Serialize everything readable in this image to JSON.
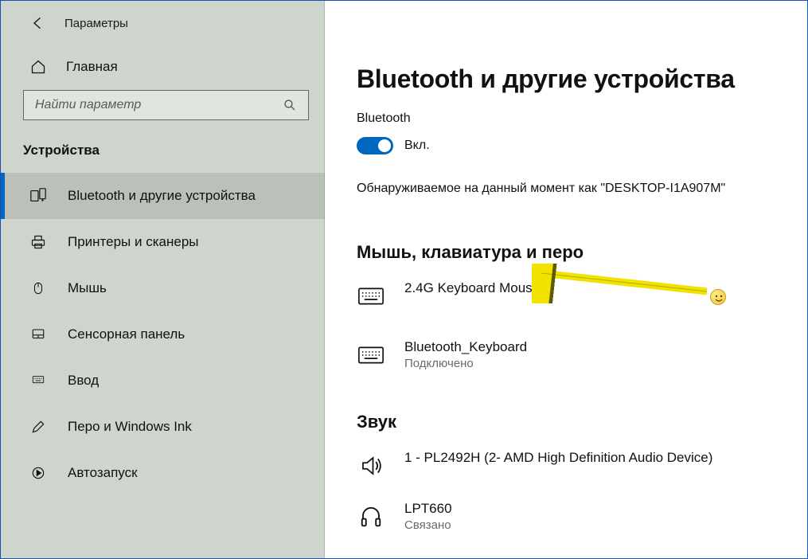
{
  "header": {
    "app_title": "Параметры"
  },
  "sidebar": {
    "home_label": "Главная",
    "search_placeholder": "Найти параметр",
    "category_label": "Устройства",
    "items": [
      {
        "label": "Bluetooth и другие устройства"
      },
      {
        "label": "Принтеры и сканеры"
      },
      {
        "label": "Мышь"
      },
      {
        "label": "Сенсорная панель"
      },
      {
        "label": "Ввод"
      },
      {
        "label": "Перо и Windows Ink"
      },
      {
        "label": "Автозапуск"
      }
    ]
  },
  "main": {
    "page_title": "Bluetooth и другие устройства",
    "bluetooth_section_label": "Bluetooth",
    "toggle_state_label": "Вкл.",
    "discoverable_text": "Обнаруживаемое на данный момент как \"DESKTOP-I1A907M\"",
    "group_input_title": "Мышь, клавиатура и перо",
    "devices_input": [
      {
        "name": "2.4G Keyboard Mouse",
        "status": ""
      },
      {
        "name": "Bluetooth_Keyboard",
        "status": "Подключено"
      }
    ],
    "group_sound_title": "Звук",
    "devices_sound": [
      {
        "name": "1 - PL2492H (2- AMD High Definition Audio Device)",
        "status": ""
      },
      {
        "name": "LPT660",
        "status": "Связано"
      }
    ]
  }
}
